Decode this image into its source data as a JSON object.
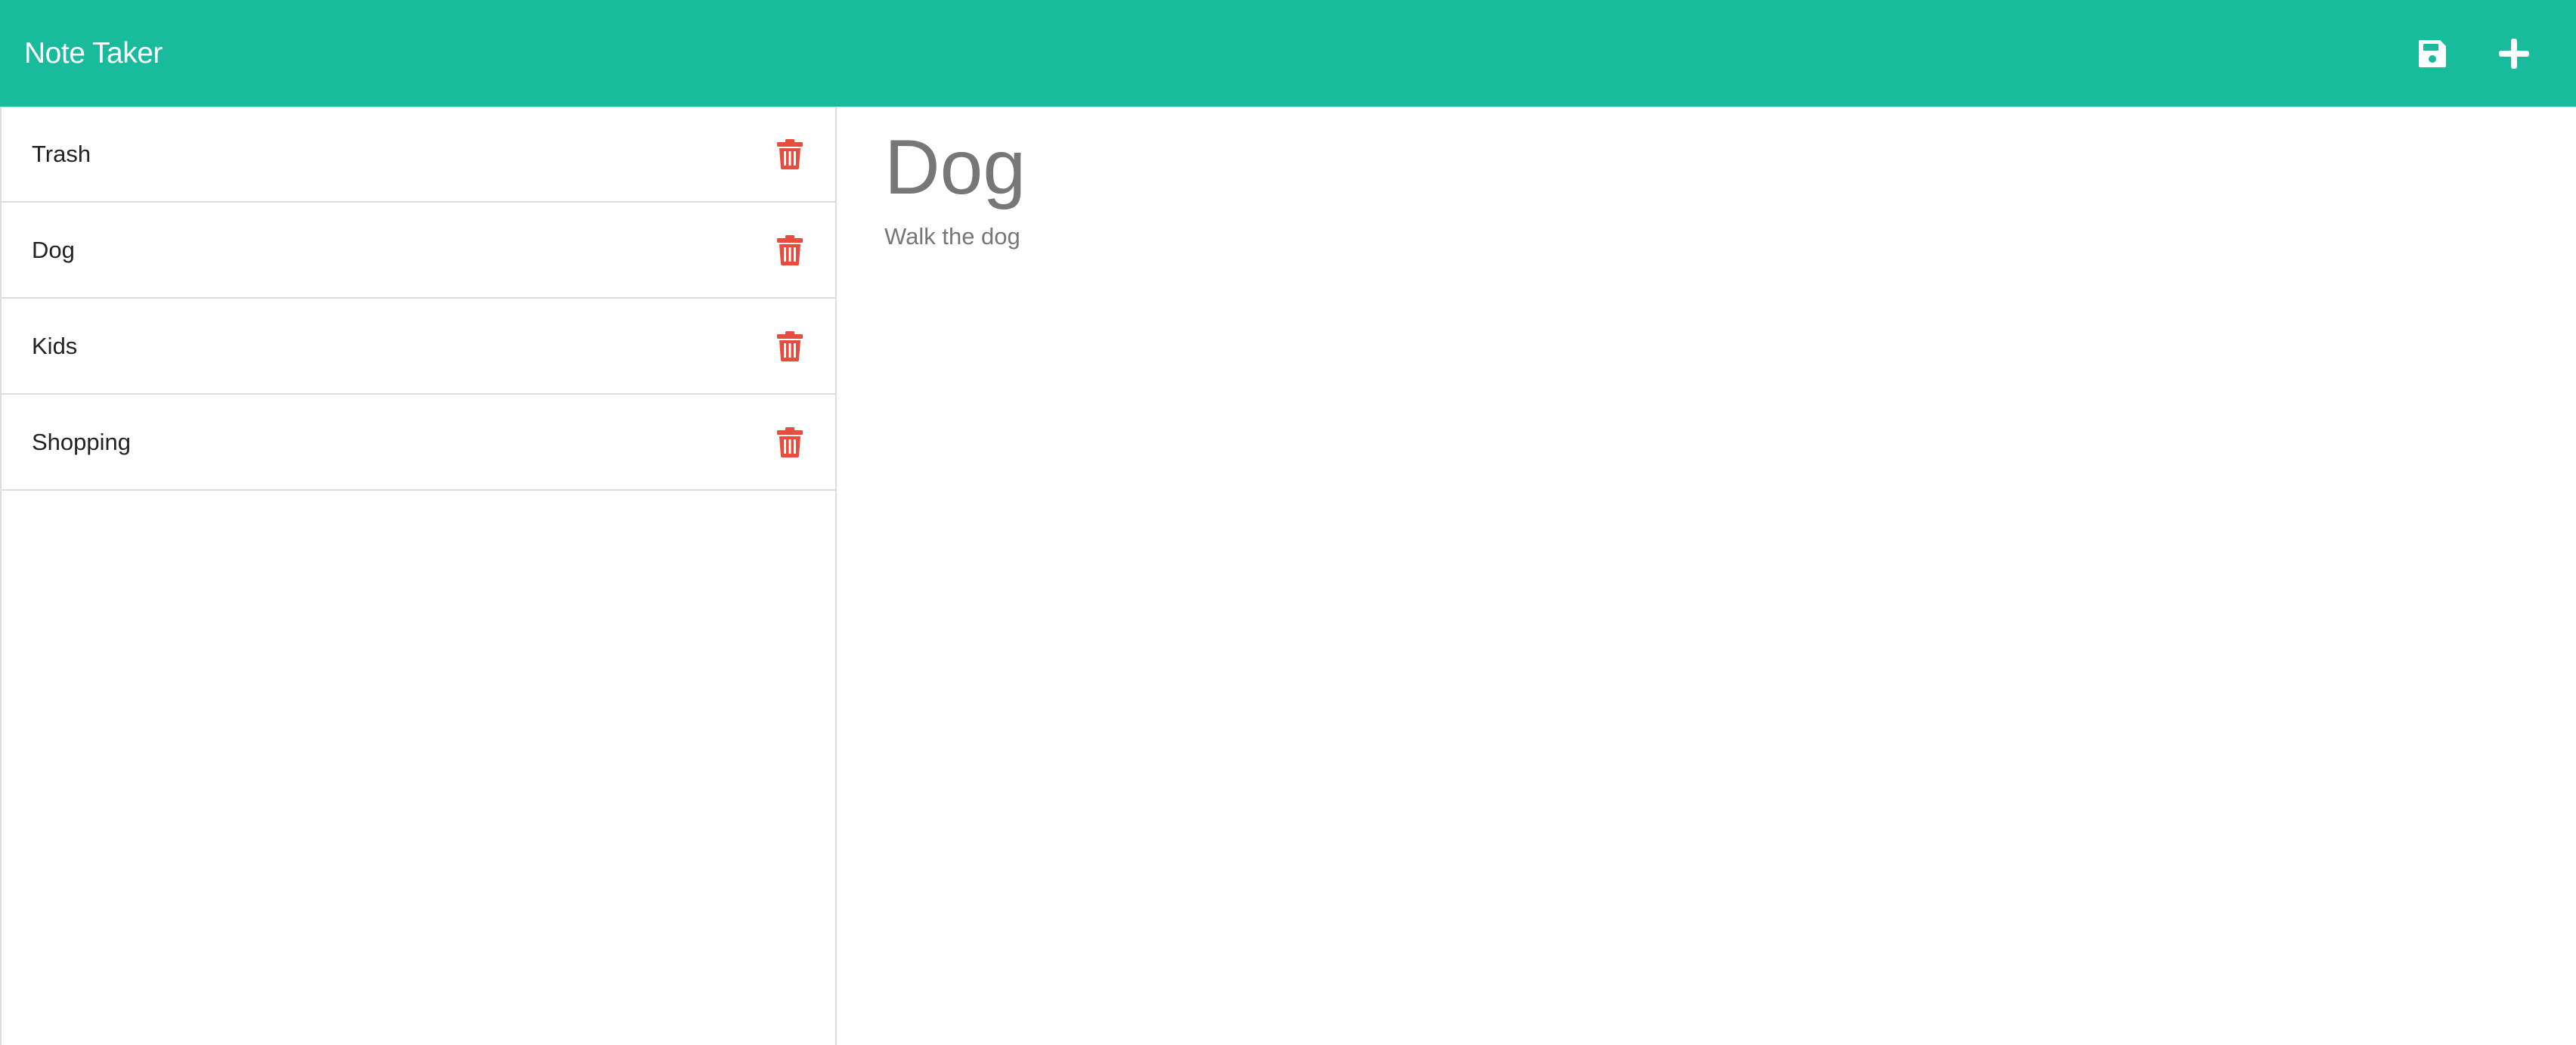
{
  "navbar": {
    "brand": "Note Taker",
    "save_icon": "save-icon",
    "new_icon": "plus-icon",
    "color": "#18bc9c"
  },
  "sidebar": {
    "notes": [
      {
        "title": "Trash"
      },
      {
        "title": "Dog"
      },
      {
        "title": "Kids"
      },
      {
        "title": "Shopping"
      }
    ],
    "delete_icon": "trash-icon",
    "delete_color": "#e74c3c"
  },
  "editor": {
    "title": "Dog",
    "text": "Walk the dog"
  }
}
